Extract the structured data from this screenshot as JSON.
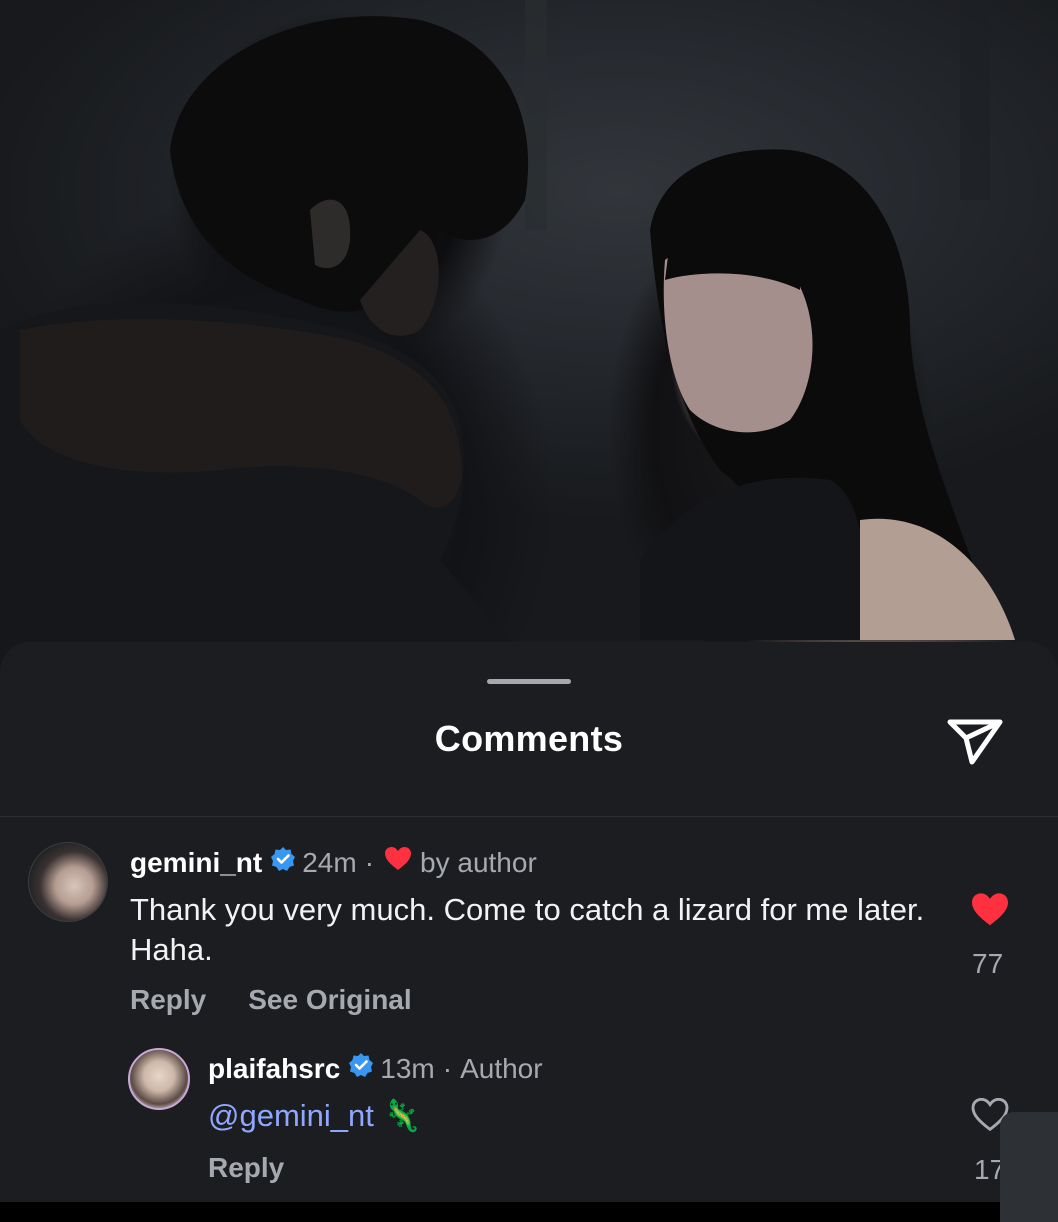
{
  "sheet": {
    "title": "Comments",
    "share_icon": "send-paper-plane-icon"
  },
  "comments": [
    {
      "username": "gemini_nt",
      "verified": true,
      "time": "24m",
      "separator": "·",
      "liked_by_author_label": "by author",
      "text": "Thank you very much. Come to catch a lizard for me later. Haha.",
      "reply_label": "Reply",
      "see_original_label": "See Original",
      "likes": "77",
      "liked": true
    },
    {
      "username": "plaifahsrc",
      "verified": true,
      "time": "13m",
      "separator": "·",
      "author_badge": "Author",
      "mention": "@gemini_nt",
      "emoji": "🦎",
      "reply_label": "Reply",
      "likes": "17",
      "liked": false
    }
  ],
  "colors": {
    "sheet_bg": "#1b1d21",
    "like_red": "#ff3040",
    "verified_blue": "#3897f0",
    "mention_blue": "#8fa8ff",
    "secondary_text": "#a6a9af"
  }
}
